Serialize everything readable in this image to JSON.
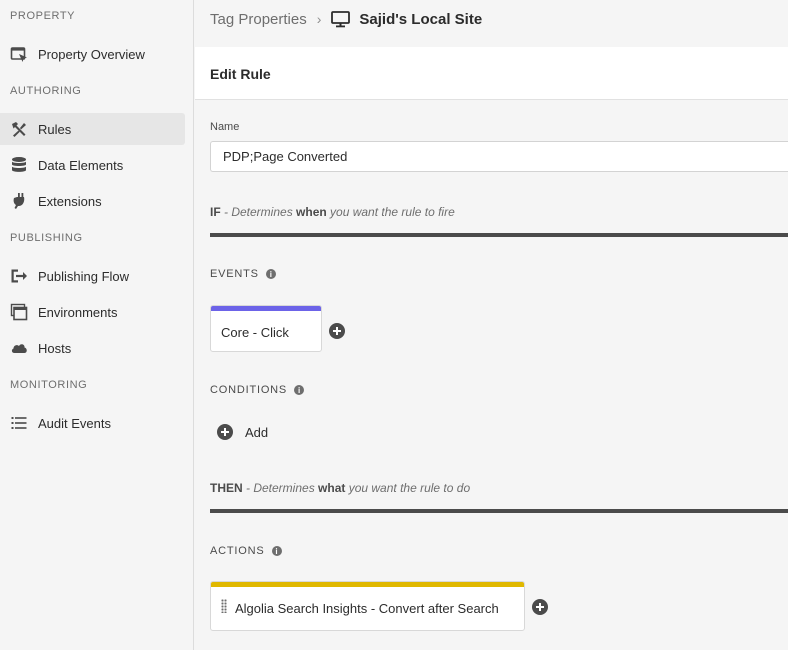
{
  "sidebar": {
    "sections": {
      "property": "PROPERTY",
      "authoring": "AUTHORING",
      "publishing": "PUBLISHING",
      "monitoring": "MONITORING"
    },
    "items": {
      "property_overview": "Property Overview",
      "rules": "Rules",
      "data_elements": "Data Elements",
      "extensions": "Extensions",
      "publishing_flow": "Publishing Flow",
      "environments": "Environments",
      "hosts": "Hosts",
      "audit_events": "Audit Events"
    },
    "active_item": "Rules"
  },
  "breadcrumb": {
    "parent": "Tag Properties",
    "separator": "›",
    "current": "Sajid's Local Site",
    "current_icon": "monitor-icon"
  },
  "editor": {
    "title": "Edit Rule",
    "name_label": "Name",
    "name_value": "PDP;Page Converted",
    "if_keyword": "IF",
    "if_text_pre": " - Determines ",
    "if_emphasis": "when",
    "if_text_post": " you want the rule to fire",
    "then_keyword": "THEN",
    "then_text_pre": " - Determines ",
    "then_emphasis": "what",
    "then_text_post": " you want the rule to do",
    "events_label": "EVENTS",
    "events": [
      {
        "label": "Core - Click",
        "accent": "#6c63e8"
      }
    ],
    "conditions_label": "CONDITIONS",
    "conditions_add_label": "Add",
    "actions_label": "ACTIONS",
    "actions": [
      {
        "label": "Algolia Search Insights - Convert after Search",
        "accent": "#e0b800"
      }
    ]
  },
  "colors": {
    "sidebar_bg": "#f5f5f5",
    "active_bg": "#e6e6e6",
    "event_accent": "#6c63e8",
    "action_accent": "#e0b800",
    "divider": "#4b4b4b"
  }
}
